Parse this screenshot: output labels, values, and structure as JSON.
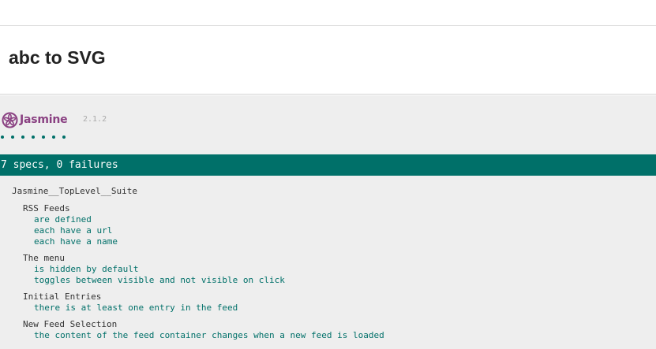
{
  "app": {
    "title": "abc to SVG"
  },
  "jasmine": {
    "brand": "Jasmine",
    "version": "2.1.2",
    "brand_color": "#8a4182",
    "passed_color": "#007069",
    "symbol_count": 7,
    "result_summary": "7 specs, 0 failures",
    "top_suite": "Jasmine__TopLevel__Suite",
    "suites": [
      {
        "name": "RSS Feeds",
        "specs": [
          "are defined",
          "each have a url",
          "each have a name"
        ]
      },
      {
        "name": "The menu",
        "specs": [
          "is hidden by default",
          "toggles between visible and not visible on click"
        ]
      },
      {
        "name": "Initial Entries",
        "specs": [
          "there is at least one entry in the feed"
        ]
      },
      {
        "name": "New Feed Selection",
        "specs": [
          "the content of the feed container changes when a new feed is loaded"
        ]
      }
    ]
  }
}
